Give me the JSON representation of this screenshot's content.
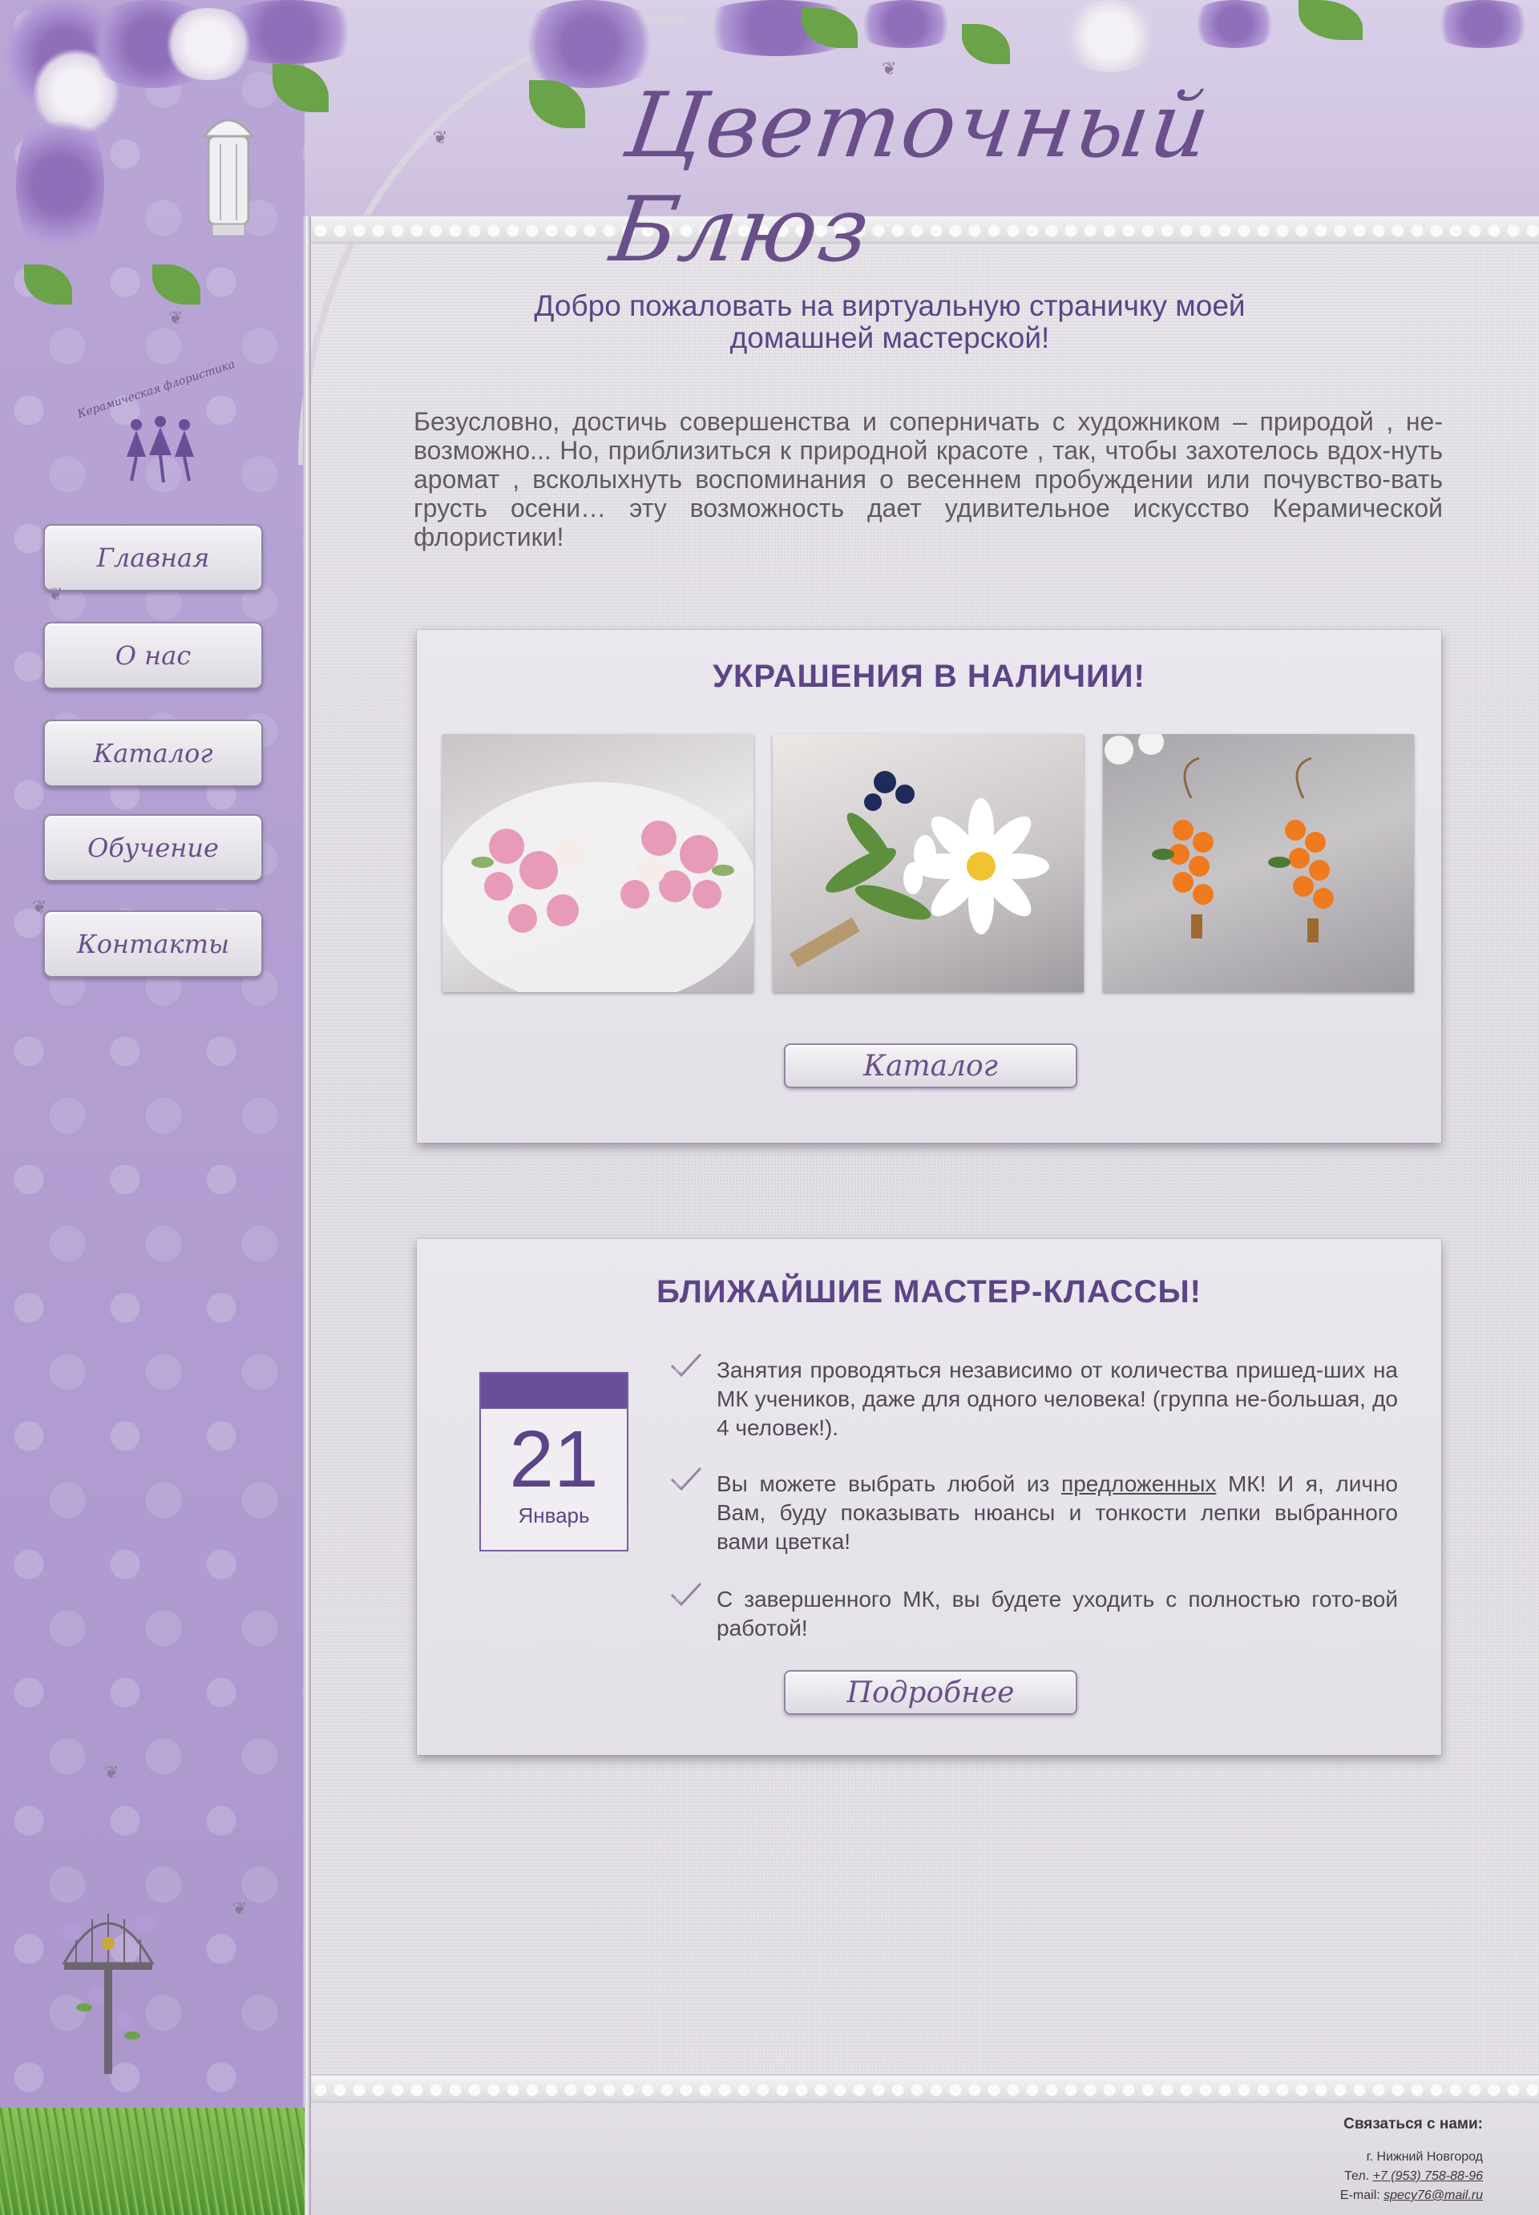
{
  "header": {
    "site_title": "Цветочный Блюз"
  },
  "logo": {
    "text": "Керамическая флористика"
  },
  "nav": {
    "items": [
      {
        "label": "Главная"
      },
      {
        "label": "О нас"
      },
      {
        "label": "Каталог"
      },
      {
        "label": "Обучение"
      },
      {
        "label": "Контакты"
      }
    ]
  },
  "welcome": {
    "line1": "Добро пожаловать на виртуальную страничку моей",
    "line2": "домашней мастерской!"
  },
  "intro": {
    "text": "Безусловно, достичь совершенства и соперничать с художником – природой , не-возможно... Но, приблизиться к природной красоте , так, чтобы захотелось вдох-нуть аромат , всколыхнуть воспоминания о весеннем пробуждении или почувство-вать грусть осени… эту возможность дает удивительное искусство Керамической флористики!"
  },
  "jewelry": {
    "heading": "УКРАШЕНИЯ В НАЛИЧИИ!",
    "button_label": "Каталог",
    "photos": [
      "roses-rings-photo",
      "chamomile-brooch-photo",
      "rowan-earrings-photo"
    ]
  },
  "classes": {
    "heading": "БЛИЖАЙШИЕ МАСТЕР-КЛАССЫ!",
    "calendar_day": "21",
    "calendar_month": "Январь",
    "point1": "Занятия  проводяться независимо от количества пришед-ших на МК учеников, даже для одного человека! (группа не-большая, до 4 человек!).",
    "point2_before": "Вы можете выбрать любой из ",
    "point2_link": "предложенных",
    "point2_after": "  МК! И я, лично Вам, буду показывать нюансы и тонкости лепки выбранного вами цветка!",
    "point3": "С завершенного МК, вы будете уходить с полностью гото-вой работой!",
    "button_label": "Подробнее"
  },
  "footer": {
    "heading": "Связаться с нами:",
    "city": "г. Нижний Новгород",
    "phone_label": "Тел. ",
    "phone": "+7 (953) 758-88-96",
    "email_label": "E-mail: ",
    "email": "specy76@mail.ru"
  },
  "colors": {
    "accent": "#5c4488",
    "sidebar": "#b39fd2",
    "header": "#d2c6e3",
    "panel": "#e8e4eb"
  }
}
